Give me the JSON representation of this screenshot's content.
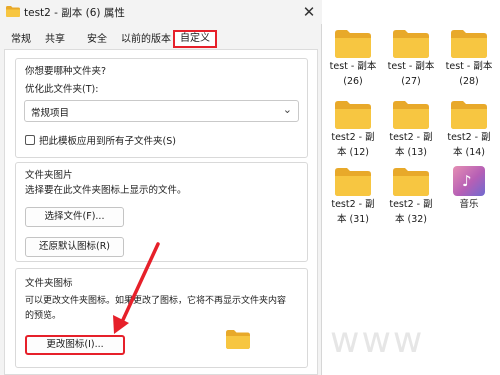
{
  "window": {
    "title": "test2 - 副本 (6) 属性",
    "close_glyph": "✕"
  },
  "tabs": [
    {
      "label": "常规",
      "active": false
    },
    {
      "label": "共享",
      "active": false
    },
    {
      "label": "安全",
      "active": false
    },
    {
      "label": "以前的版本",
      "active": false
    },
    {
      "label": "自定义",
      "active": true
    }
  ],
  "folder_type": {
    "heading": "你想要哪种文件夹?",
    "optimize_label": "优化此文件夹(T):",
    "selected_value": "常规项目",
    "apply_subfolders_label": "把此模板应用到所有子文件夹(S)",
    "apply_subfolders_checked": false
  },
  "folder_pictures": {
    "heading": "文件夹图片",
    "description": "选择要在此文件夹图标上显示的文件。",
    "choose_file_button": "选择文件(F)...",
    "restore_default_button": "还原默认图标(R)"
  },
  "folder_icons": {
    "heading": "文件夹图标",
    "description_line1": "可以更改文件夹图标。如果更改了图标，它将不再显示文件夹内容",
    "description_line2": "的预览。",
    "change_icon_button": "更改图标(I)..."
  },
  "desktop_items": [
    {
      "line1": "test - 副本",
      "line2": "(26)",
      "type": "folder"
    },
    {
      "line1": "test - 副本",
      "line2": "(27)",
      "type": "folder"
    },
    {
      "line1": "test - 副本",
      "line2": "(28)",
      "type": "folder"
    },
    {
      "line1": "test2 - 副",
      "line2": "本 (12)",
      "type": "folder"
    },
    {
      "line1": "test2 - 副",
      "line2": "本 (13)",
      "type": "folder"
    },
    {
      "line1": "test2 - 副",
      "line2": "本 (14)",
      "type": "folder"
    },
    {
      "line1": "test2 - 副",
      "line2": "本 (31)",
      "type": "folder"
    },
    {
      "line1": "test2 - 副",
      "line2": "本 (32)",
      "type": "folder"
    },
    {
      "line1": "音乐",
      "line2": "",
      "type": "music"
    }
  ],
  "colors": {
    "highlight": "#e6202a",
    "folder_yellow": "#f7c641",
    "folder_back": "#e8a92a"
  },
  "watermark": "www"
}
